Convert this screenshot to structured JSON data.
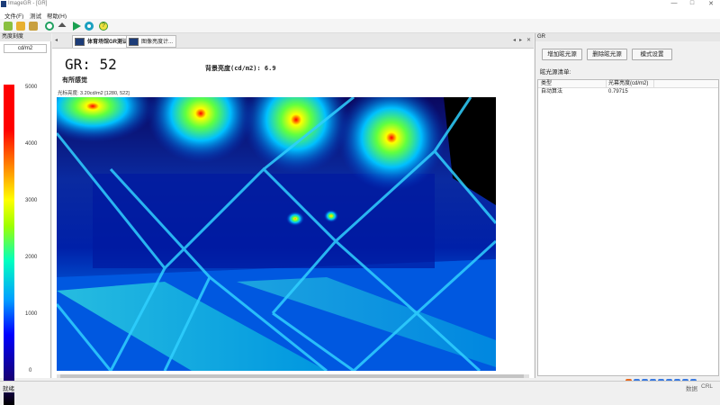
{
  "window": {
    "title": "ImageGR - [GR]",
    "controls": [
      "—",
      "□",
      "✕"
    ]
  },
  "menu": {
    "items": [
      "文件(F)",
      "测试",
      "帮助(H)"
    ]
  },
  "toolbar": {
    "icons": [
      "new-icon",
      "open-icon",
      "save-icon",
      "settings-icon",
      "eject-icon",
      "play-icon",
      "record-icon",
      "help-icon"
    ]
  },
  "left_panel": {
    "title": "亮度刻度",
    "unit": "cd/m2",
    "ticks": [
      "5000",
      "4000",
      "3000",
      "2000",
      "1000",
      "0"
    ]
  },
  "tabs": [
    {
      "label": "体育场馆GR测试"
    },
    {
      "label": "眩光..."
    },
    {
      "label": "图像亮度计..."
    }
  ],
  "measurement": {
    "gr_label": "GR: 52",
    "background_label": "背景亮度(cd/m2): 6.9",
    "perception": "有所感觉",
    "cursor_info": "光标亮度: 3.20cd/m2 [1280, 522]"
  },
  "right_panel": {
    "title": "GR",
    "buttons": [
      "增加眩光源",
      "删除眩光源",
      "模式设置"
    ],
    "list_label": "眩光源清单:",
    "table": {
      "headers": [
        "类型",
        "光幕亮度(cd/m2)"
      ],
      "rows": [
        [
          "自动算法",
          "0.79715"
        ]
      ]
    }
  },
  "status": {
    "left": "就绪",
    "right_a": "数据",
    "right_b": "CRL"
  },
  "colors": {
    "accent": "#1e6fc8",
    "colorbar_top": "#ff0000",
    "colorbar_bottom": "#000000"
  }
}
